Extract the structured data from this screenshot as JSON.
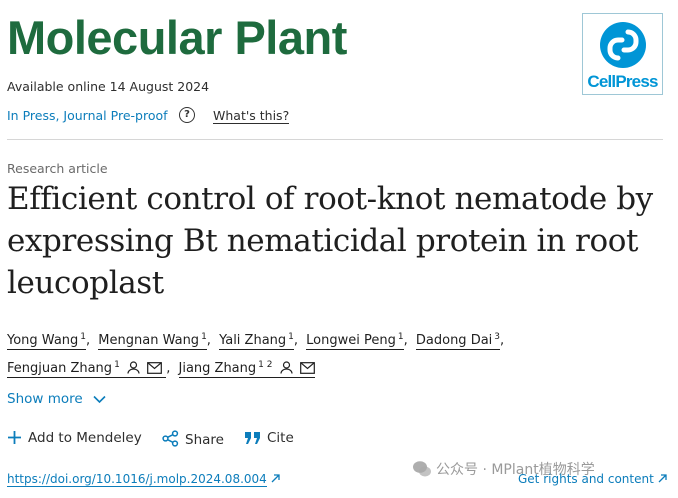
{
  "journal": {
    "title": "Molecular Plant",
    "publisher_logo_text": "CellPress"
  },
  "meta": {
    "available": "Available online 14 August 2024",
    "status": "In Press, Journal Pre-proof",
    "whats_this": "What's this?"
  },
  "article": {
    "type": "Research article",
    "title": "Efficient control of root-knot nematode by expressing Bt nematicidal protein in root leucoplast"
  },
  "authors": [
    {
      "name": "Yong Wang",
      "sup": "1"
    },
    {
      "name": "Mengnan Wang",
      "sup": "1"
    },
    {
      "name": "Yali Zhang",
      "sup": "1"
    },
    {
      "name": "Longwei Peng",
      "sup": "1"
    },
    {
      "name": "Dadong Dai",
      "sup": "3"
    },
    {
      "name": "Fengjuan Zhang",
      "sup": "1",
      "icons": [
        "person-icon",
        "mail-icon"
      ]
    },
    {
      "name": "Jiang Zhang",
      "sup": "1 2",
      "icons": [
        "person-icon",
        "mail-icon"
      ]
    }
  ],
  "show_more": "Show more",
  "actions": {
    "mendeley": "Add to Mendeley",
    "share": "Share",
    "cite": "Cite"
  },
  "doi": "https://doi.org/10.1016/j.molp.2024.08.004",
  "rights": "Get rights and content",
  "watermark": "公众号 · MPlant植物科学",
  "colors": {
    "journal_green": "#1e6b3e",
    "link_blue": "#0c7dbb",
    "cellpress_blue": "#0095d6"
  }
}
